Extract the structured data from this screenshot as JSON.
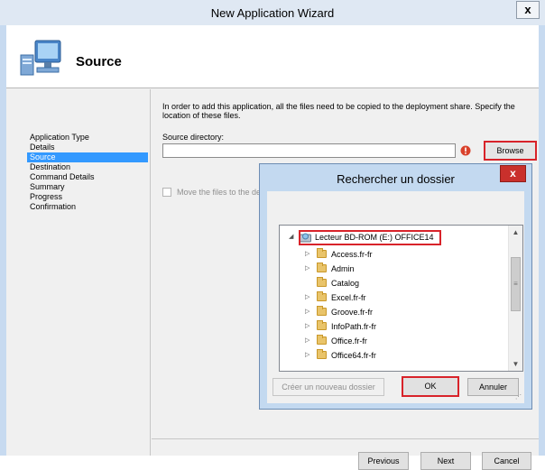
{
  "window": {
    "title": "New Application Wizard",
    "close_label": "x"
  },
  "header": {
    "title": "Source",
    "icon": "computer-icon"
  },
  "nav": {
    "items": [
      {
        "label": "Application Type",
        "active": false
      },
      {
        "label": "Details",
        "active": false
      },
      {
        "label": "Source",
        "active": true
      },
      {
        "label": "Destination",
        "active": false
      },
      {
        "label": "Command Details",
        "active": false
      },
      {
        "label": "Summary",
        "active": false
      },
      {
        "label": "Progress",
        "active": false
      },
      {
        "label": "Confirmation",
        "active": false
      }
    ]
  },
  "content": {
    "instructions": "In order to add this application, all the files need to be copied to the deployment share.  Specify the location of these files.",
    "source_label": "Source directory:",
    "source_value": "",
    "browse_label": "Browse",
    "move_label": "Move the files to the de",
    "move_checked": false
  },
  "footer": {
    "previous_label": "Previous",
    "next_label": "Next",
    "cancel_label": "Cancel"
  },
  "dialog": {
    "title": "Rechercher un dossier",
    "close_label": "x",
    "drive_label": "Lecteur BD-ROM (E:) OFFICE14",
    "folders": [
      {
        "label": "Access.fr-fr",
        "expandable": true
      },
      {
        "label": "Admin",
        "expandable": true
      },
      {
        "label": "Catalog",
        "expandable": false
      },
      {
        "label": "Excel.fr-fr",
        "expandable": true
      },
      {
        "label": "Groove.fr-fr",
        "expandable": true
      },
      {
        "label": "InfoPath.fr-fr",
        "expandable": true
      },
      {
        "label": "Office.fr-fr",
        "expandable": true
      },
      {
        "label": "Office64.fr-fr",
        "expandable": true
      }
    ],
    "new_folder_label": "Créer un nouveau dossier",
    "ok_label": "OK",
    "cancel_label": "Annuler"
  },
  "colors": {
    "highlight_red": "#d8232a",
    "selection_blue": "#3399ff",
    "chrome_blue": "#c7daf0"
  }
}
